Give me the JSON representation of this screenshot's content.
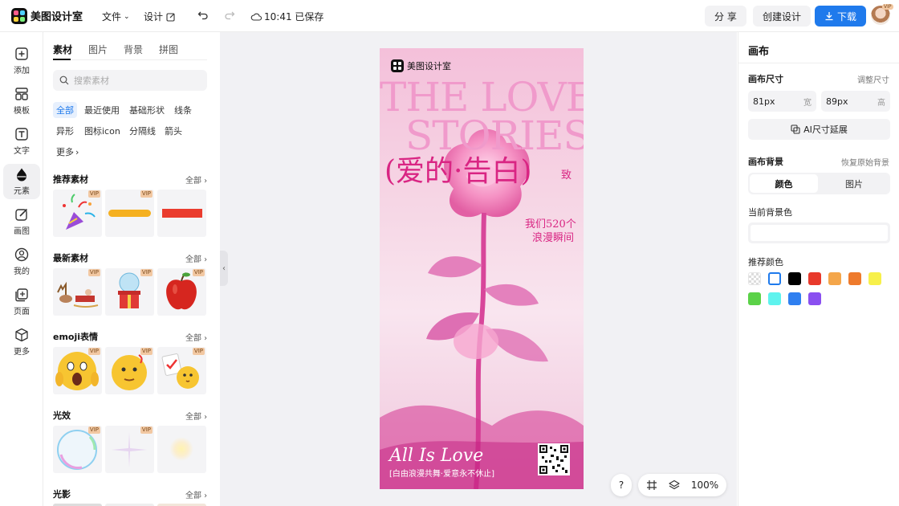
{
  "header": {
    "app_name": "美图设计室",
    "menu_file": "文件",
    "menu_design": "设计",
    "save_status": "10:41 已保存",
    "share": "分 享",
    "create": "创建设计",
    "download": "下载",
    "avatar_badge": "VIP"
  },
  "leftnav": [
    {
      "label": "添加",
      "icon": "plus-square-icon"
    },
    {
      "label": "模板",
      "icon": "template-icon"
    },
    {
      "label": "文字",
      "icon": "text-icon"
    },
    {
      "label": "元素",
      "icon": "shapes-icon"
    },
    {
      "label": "画图",
      "icon": "pen-icon"
    },
    {
      "label": "我的",
      "icon": "user-icon"
    },
    {
      "label": "页面",
      "icon": "page-add-icon"
    },
    {
      "label": "更多",
      "icon": "cube-icon"
    }
  ],
  "assets": {
    "tabs": [
      "素材",
      "图片",
      "背景",
      "拼图"
    ],
    "search_placeholder": "搜索素材",
    "chips": [
      "全部",
      "最近使用",
      "基础形状",
      "线条",
      "异形",
      "图标icon",
      "分隔线",
      "箭头",
      "更多"
    ],
    "all_label": "全部",
    "vip": "VIP",
    "sections": [
      {
        "title": "推荐素材"
      },
      {
        "title": "最新素材"
      },
      {
        "title": "emoji表情"
      },
      {
        "title": "光效"
      },
      {
        "title": "光影"
      }
    ]
  },
  "poster": {
    "brand": "美图设计室",
    "title_line1": "THE LOVE",
    "title_line2": "STORIES",
    "subtitle": "(爱的·告白)",
    "subtitle_suffix": "致",
    "tagline1": "我们520个",
    "tagline2": "浪漫瞬间",
    "footer_title": "All Is Love",
    "footer_sub": "[白由浪漫共舞·爱意永不休止]"
  },
  "floatbar": {
    "help": "?",
    "zoom": "100%"
  },
  "rightpanel": {
    "title": "画布",
    "size_label": "画布尺寸",
    "size_link": "调整尺寸",
    "width_value": "81px",
    "width_unit": "宽",
    "height_value": "89px",
    "height_unit": "高",
    "ai_extend": "AI尺寸延展",
    "bg_label": "画布背景",
    "bg_reset": "恢复原始背景",
    "bg_tab_color": "颜色",
    "bg_tab_image": "图片",
    "current_bg": "当前背景色",
    "recommend": "推荐颜色",
    "colors": [
      "transparent",
      "#ffffff",
      "#000000",
      "#e8392b",
      "#f4a64a",
      "#ee7a2c",
      "#f7f04a",
      "#5bd248",
      "#5ef3ee",
      "#2f7ff0",
      "#8a4ff0"
    ]
  }
}
